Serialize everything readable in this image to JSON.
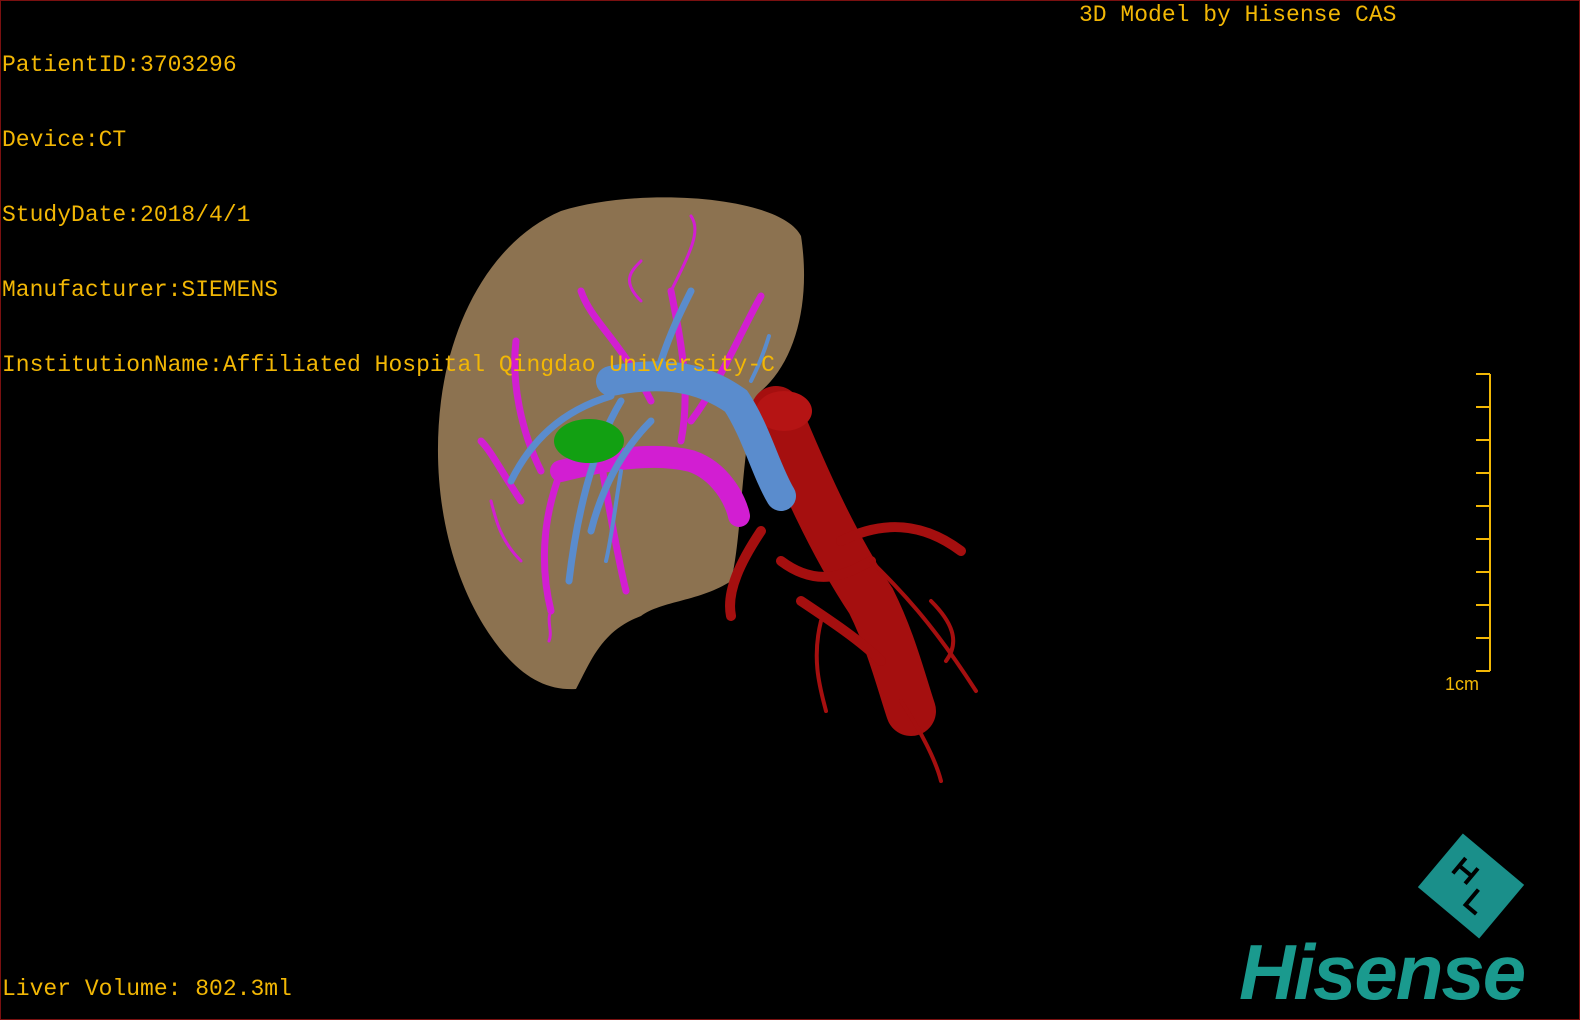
{
  "info": {
    "patient_id": "PatientID:3703296",
    "device": "Device:CT",
    "study_date": "StudyDate:2018/4/1",
    "manufacturer": "Manufacturer:SIEMENS",
    "institution": "InstitutionName:Affiliated Hospital Qingdao University-C"
  },
  "model_title": "3D Model by Hisense CAS",
  "liver_volume": "Liver Volume: 802.3ml",
  "scale": {
    "label": "1cm",
    "ticks": 10
  },
  "logo": {
    "text": "Hisense",
    "mark": "HT"
  },
  "colors": {
    "text": "#f2b705",
    "liver": "#8c7250",
    "portal_vein": "#d21ed2",
    "hepatic_vein": "#5a8ccd",
    "artery": "#a50f0f",
    "lesion": "#12a012",
    "brand": "#1a9a8e"
  }
}
